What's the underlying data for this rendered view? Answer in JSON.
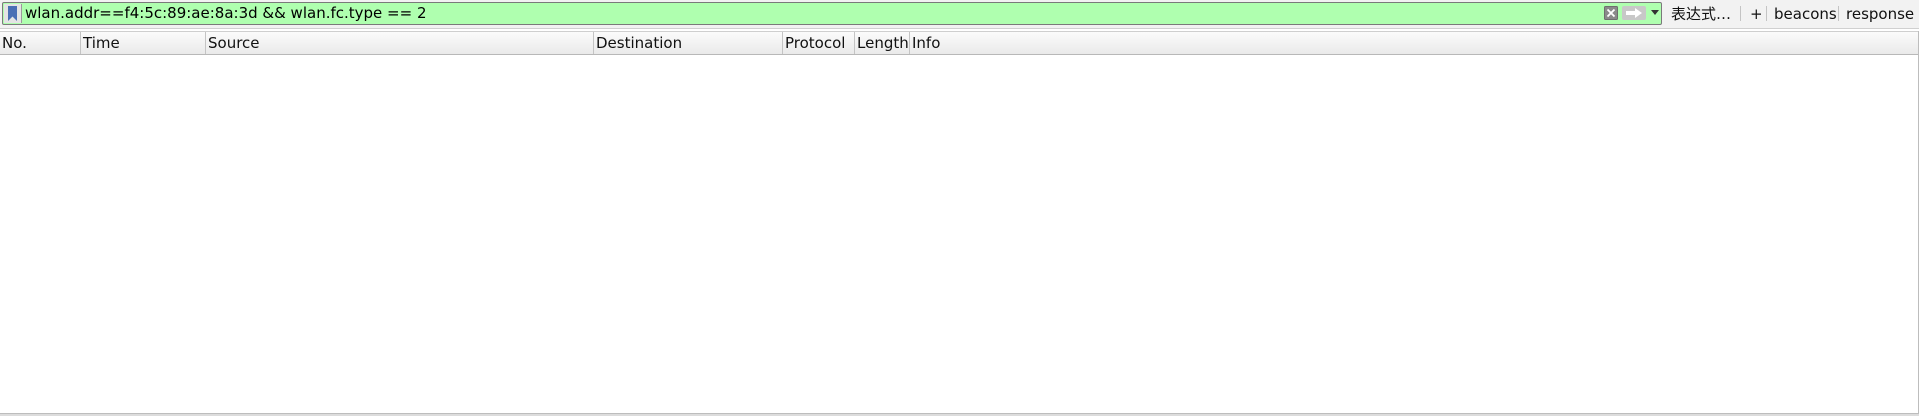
{
  "filter_toolbar": {
    "filter_value": "wlan.addr==f4:5c:89:ae:8a:3d && wlan.fc.type == 2",
    "background_color": "#afffaf",
    "icons": {
      "bookmark": "bookmark-icon",
      "clear": "clear-icon",
      "apply": "arrow-right-icon",
      "dropdown": "chevron-down-icon"
    },
    "expression_label": "表达式…",
    "add_label": "+",
    "saved_filters": [
      "beacons",
      "response"
    ]
  },
  "packet_list": {
    "columns": [
      "No.",
      "Time",
      "Source",
      "Destination",
      "Protocol",
      "Length",
      "Info"
    ],
    "rows": []
  }
}
